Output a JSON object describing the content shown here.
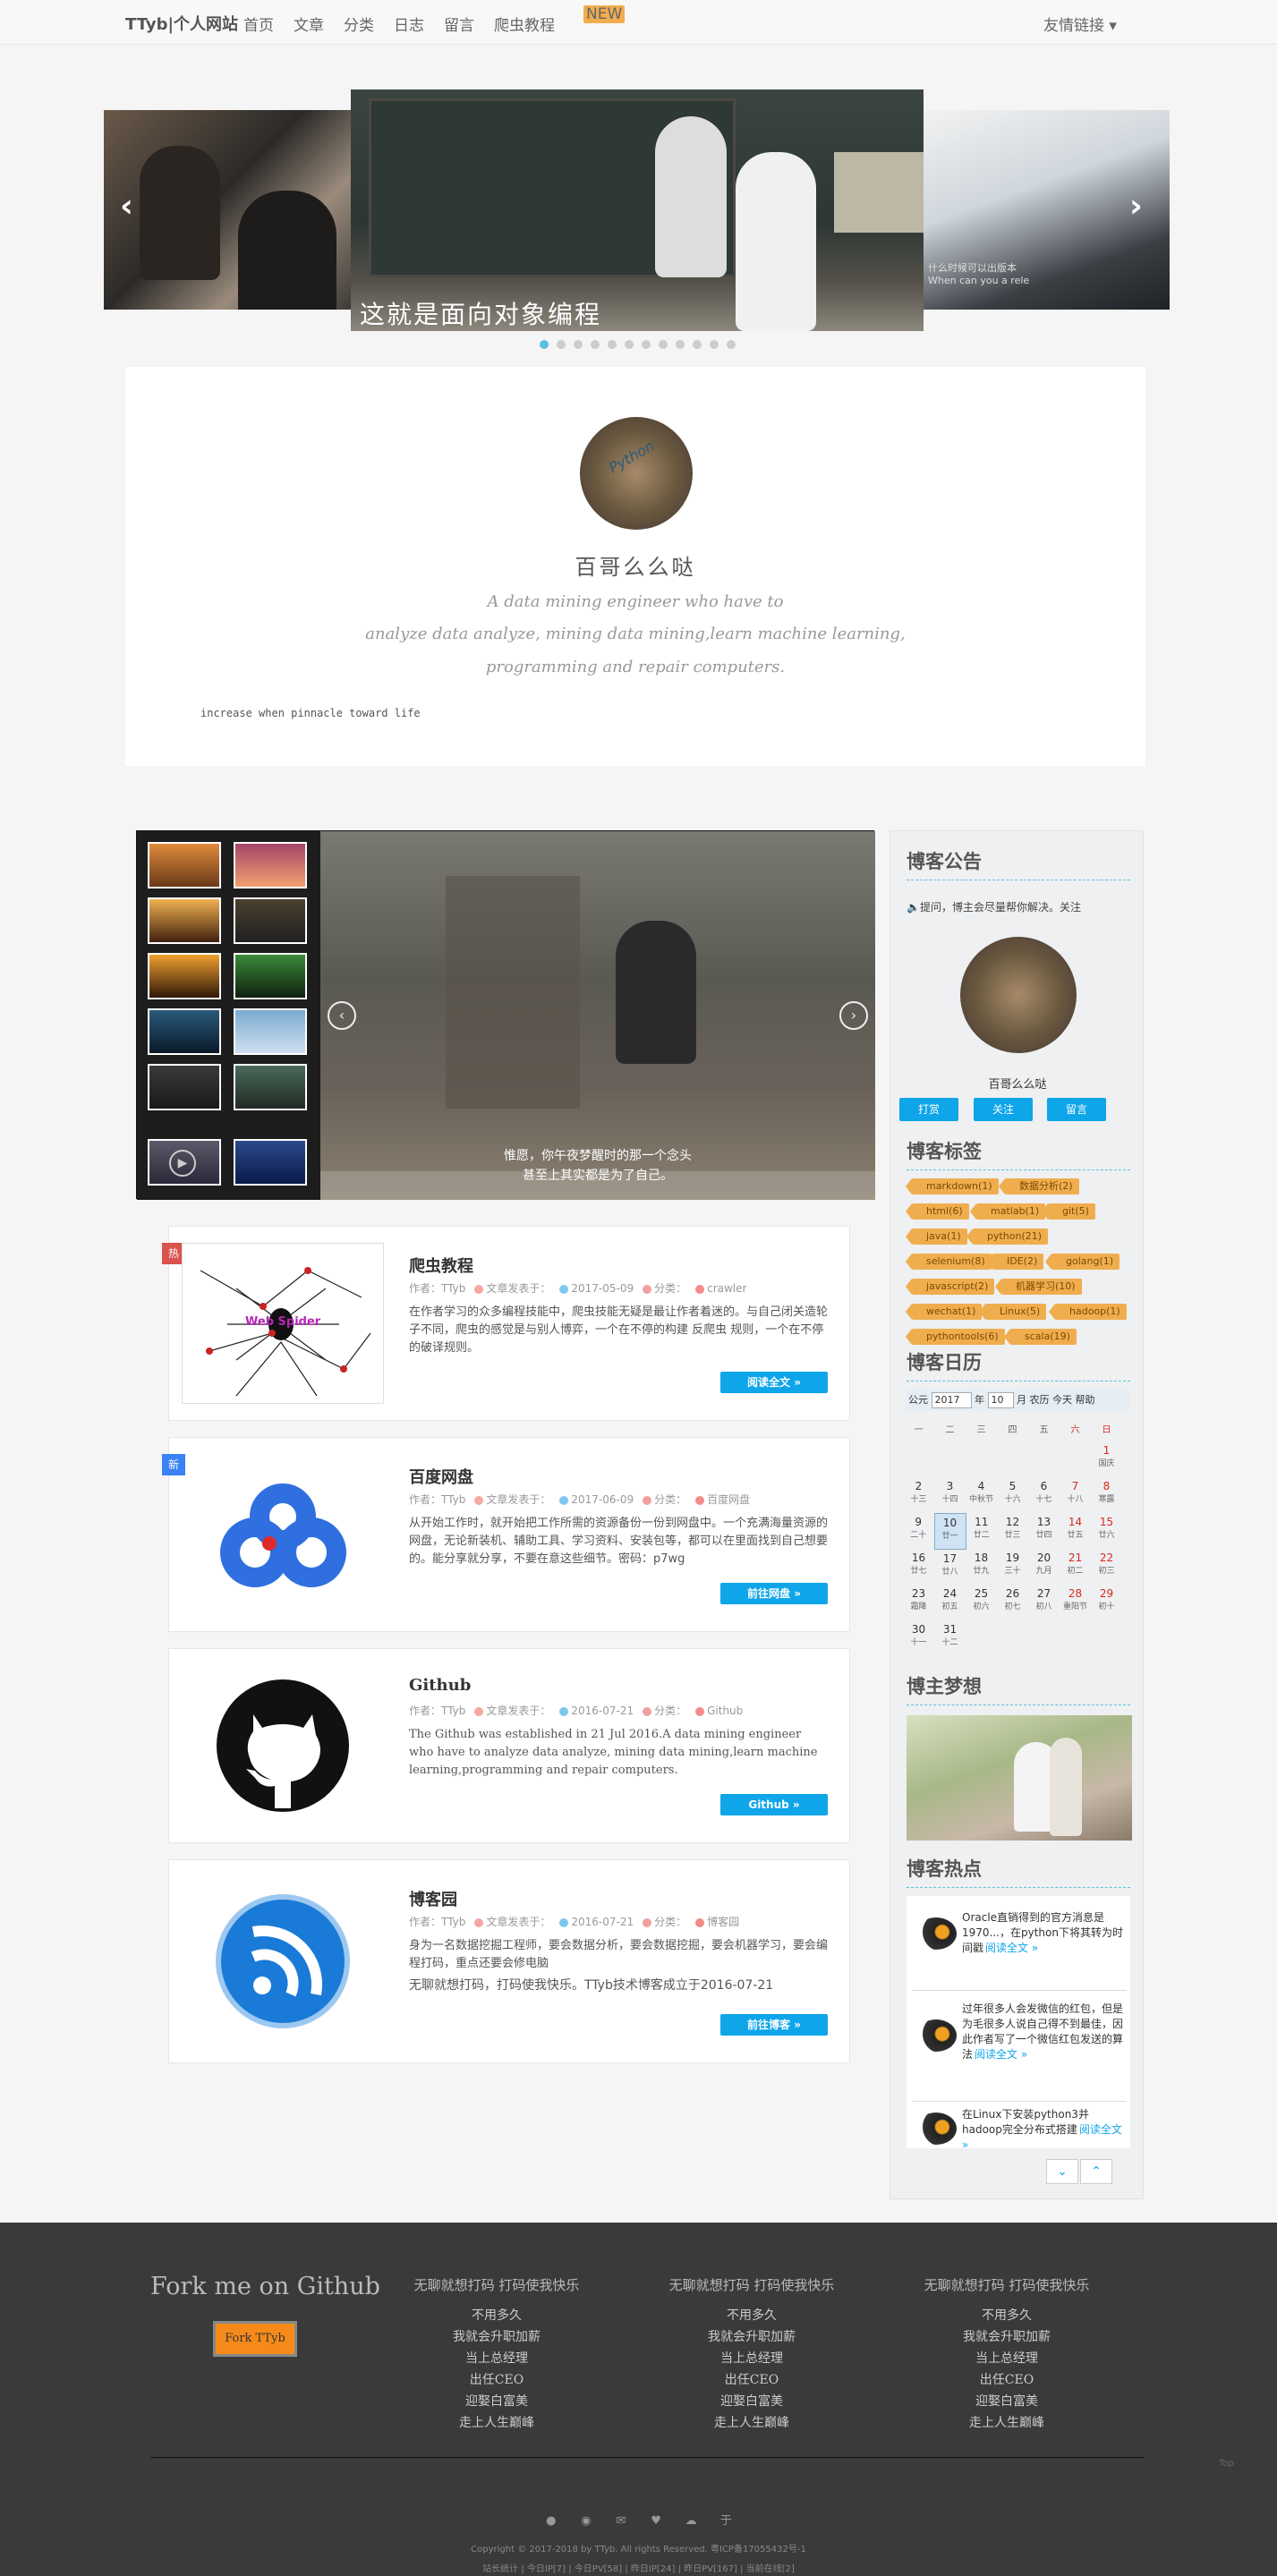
{
  "nav": {
    "brand": "TTyb|个人网站",
    "links": [
      "首页",
      "文章",
      "分类",
      "日志",
      "留言",
      "爬虫教程"
    ],
    "new_badge": "NEW",
    "friend_links": "友情链接 ▾"
  },
  "carousel": {
    "caption": "这就是面向对象编程",
    "right_caption_1": "什么时候可以出版本",
    "right_caption_2": "When can you a rele",
    "dots_count": 12,
    "active_dot": 0
  },
  "profile": {
    "name": "百哥么么哒",
    "tagline_1": "A data mining engineer who have to",
    "tagline_2": "analyze data analyze, mining data mining,learn machine learning,",
    "tagline_3": "programming and repair computers.",
    "motto": "increase when pinnacle toward life"
  },
  "gallery": {
    "caption_1": "惟愿，你午夜梦醒时的那一个念头",
    "caption_2": "甚至上其实都是为了自己。"
  },
  "posts": [
    {
      "badge": "热",
      "badge_color": "#d9534f",
      "title": "爬虫教程",
      "author_label": "作者：",
      "author": "TTyb",
      "date_label": "文章发表于：",
      "date": "2017-05-09",
      "cat_label": "分类：",
      "category": "crawler",
      "body": "在作者学习的众多编程技能中，爬虫技能无疑是最让作者着迷的。与自己闭关造轮子不同，爬虫的感觉是与别人博弈，一个在不停的构建 反爬虫 规则，一个在不停的破译规则。",
      "button": "阅读全文 »",
      "image_label": "Web Spider"
    },
    {
      "badge": "新",
      "badge_color": "#3b82f6",
      "title": "百度网盘",
      "author_label": "作者：",
      "author": "TTyb",
      "date_label": "文章发表于：",
      "date": "2017-06-09",
      "cat_label": "分类：",
      "category": "百度网盘",
      "body": "从开始工作时，就开始把工作所需的资源备份一份到网盘中。一个充满海量资源的网盘，无论新装机、辅助工具、学习资料、安装包等，都可以在里面找到自己想要的。能分享就分享，不要在意这些细节。密码：p7wg",
      "button": "前往网盘 »"
    },
    {
      "badge": "",
      "badge_color": "",
      "title": "Github",
      "author_label": "作者：",
      "author": "TTyb",
      "date_label": "文章发表于：",
      "date": "2016-07-21",
      "cat_label": "分类：",
      "category": "Github",
      "body": "The Github was established in 21 Jul 2016.A data mining engineer who have to analyze data analyze, mining data mining,learn machine learning,programming and repair computers.",
      "button": "Github »"
    },
    {
      "badge": "",
      "badge_color": "",
      "title": "博客园",
      "author_label": "作者：",
      "author": "TTyb",
      "date_label": "文章发表于：",
      "date": "2016-07-21",
      "cat_label": "分类：",
      "category": "博客园",
      "body": "身为一名数据挖掘工程师，要会数据分析，要会数据挖掘，要会机器学习，要会编程打码，重点还要会修电脑",
      "body2": "无聊就想打码，打码使我快乐。TTyb技术博客成立于2016-07-21",
      "button": "前往博客 »"
    }
  ],
  "sidebar": {
    "notice_title": "博客公告",
    "notice_text": "提问，博主会尽量帮你解决。关注",
    "profile_name": "百哥么么哒",
    "buttons": [
      "打赏",
      "关注",
      "留言"
    ],
    "tags_title": "博客标签",
    "tags": [
      [
        "markdown(1)",
        "数据分析(2)"
      ],
      [
        "html(6)",
        "matlab(1)",
        "git(5)"
      ],
      [
        "java(1)",
        "python(21)"
      ],
      [
        "selenium(8)",
        "IDE(2)",
        "golang(1)"
      ],
      [
        "javascript(2)",
        "机器学习(10)"
      ],
      [
        "wechat(1)",
        "Linux(5)",
        "hadoop(1)"
      ],
      [
        "pythontools(6)",
        "scala(19)"
      ]
    ],
    "calendar_title": "博客日历",
    "calendar_header": {
      "era": "公元",
      "year": "2017",
      "month": "10",
      "unit": "月",
      "back": "农历",
      "today": "今天",
      "help": "帮助"
    },
    "weekdays": [
      "一",
      "二",
      "三",
      "四",
      "五",
      "六",
      "日"
    ],
    "weeks": [
      [
        [
          "",
          ""
        ],
        [
          "",
          ""
        ],
        [
          "",
          ""
        ],
        [
          "",
          ""
        ],
        [
          "",
          ""
        ],
        [
          "",
          ""
        ],
        [
          "1",
          "国庆"
        ]
      ],
      [
        [
          "2",
          "十三"
        ],
        [
          "3",
          "十四"
        ],
        [
          "4",
          "中秋节"
        ],
        [
          "5",
          "十六"
        ],
        [
          "6",
          "十七"
        ],
        [
          "7",
          "十八"
        ],
        [
          "8",
          "寒露"
        ]
      ],
      [
        [
          "9",
          "二十"
        ],
        [
          "10",
          "廿一"
        ],
        [
          "11",
          "廿二"
        ],
        [
          "12",
          "廿三"
        ],
        [
          "13",
          "廿四"
        ],
        [
          "14",
          "廿五"
        ],
        [
          "15",
          "廿六"
        ]
      ],
      [
        [
          "16",
          "廿七"
        ],
        [
          "17",
          "廿八"
        ],
        [
          "18",
          "廿九"
        ],
        [
          "19",
          "三十"
        ],
        [
          "20",
          "九月"
        ],
        [
          "21",
          "初二"
        ],
        [
          "22",
          "初三"
        ]
      ],
      [
        [
          "23",
          "霜降"
        ],
        [
          "24",
          "初五"
        ],
        [
          "25",
          "初六"
        ],
        [
          "26",
          "初七"
        ],
        [
          "27",
          "初八"
        ],
        [
          "28",
          "重阳节"
        ],
        [
          "29",
          "初十"
        ]
      ],
      [
        [
          "30",
          "十一"
        ],
        [
          "31",
          "十二"
        ],
        [
          "",
          ""
        ],
        [
          "",
          ""
        ],
        [
          "",
          ""
        ],
        [
          "",
          ""
        ],
        [
          "",
          ""
        ]
      ]
    ],
    "dream_title": "博主梦想",
    "hot_title": "博客热点",
    "hot": [
      {
        "text": "Oracle直销得到的官方消息是1970...，在python下将其转为时间戳",
        "link": "阅读全文 »"
      },
      {
        "text": "过年很多人会发微信的红包，但是为毛很多人说自己得不到最佳，因此作者写了一个微信红包发送的算法",
        "link": "阅读全文 »"
      },
      {
        "text": "在Linux下安装python3并hadoop完全分布式搭建",
        "link": "阅读全文 »"
      }
    ]
  },
  "footer": {
    "fork_title": "Fork me on Github",
    "fork_button": "Fork TTyb",
    "col_title": "无聊就想打码 打码使我快乐",
    "col_items": [
      "不用多久",
      "我就会升职加薪",
      "当上总经理",
      "出任CEO",
      "迎娶白富美",
      "走上人生巅峰"
    ],
    "copyright": "Copyright © 2017-2018 by TTyb. All rights Reserved. 粤ICP备17055432号-1",
    "stats": "站长统计 | 今日IP[7] | 今日PV[58] | 昨日IP[24] | 昨日PV[167] | 当前在线[2]",
    "top": "Top"
  },
  "colors": {
    "accent": "#0ea5e9",
    "tag": "#f0ad4e",
    "footer": "#3a3a3a"
  }
}
